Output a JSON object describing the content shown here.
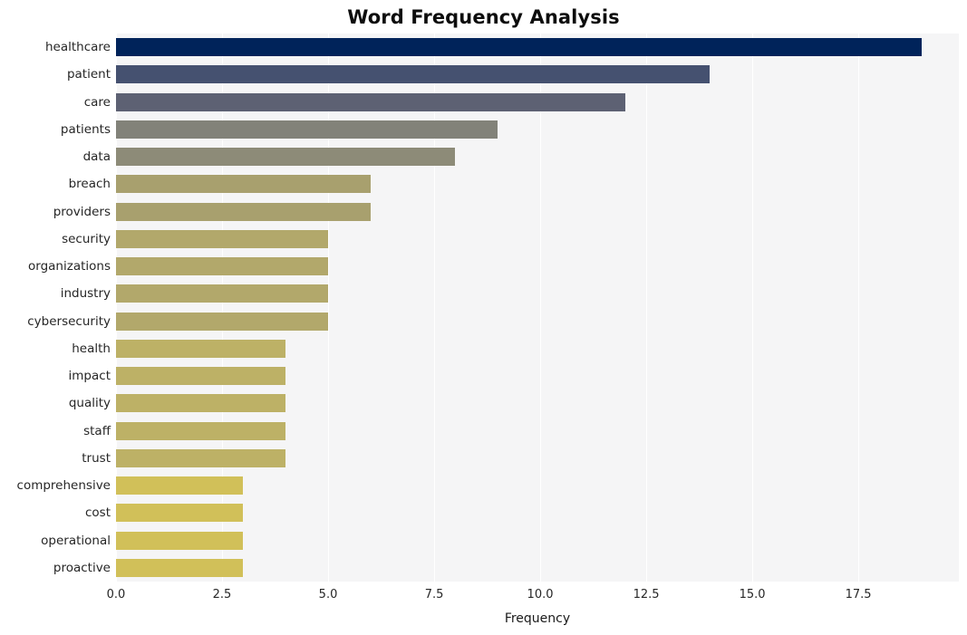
{
  "chart_data": {
    "type": "bar",
    "orientation": "horizontal",
    "title": "Word Frequency Analysis",
    "xlabel": "Frequency",
    "ylabel": "",
    "categories": [
      "healthcare",
      "patient",
      "care",
      "patients",
      "data",
      "breach",
      "providers",
      "security",
      "organizations",
      "industry",
      "cybersecurity",
      "health",
      "impact",
      "quality",
      "staff",
      "trust",
      "comprehensive",
      "cost",
      "operational",
      "proactive"
    ],
    "values": [
      19,
      14,
      12,
      9,
      8,
      6,
      6,
      5,
      5,
      5,
      5,
      4,
      4,
      4,
      4,
      4,
      3,
      3,
      3,
      3
    ],
    "bar_colors": [
      "#00235a",
      "#455170",
      "#5d6173",
      "#828279",
      "#8d8b78",
      "#a8a06e",
      "#a8a06e",
      "#b2a86b",
      "#b2a86b",
      "#b2a86b",
      "#b2a86b",
      "#bdb166",
      "#bdb166",
      "#bdb166",
      "#bdb166",
      "#bdb166",
      "#d1c059",
      "#d1c059",
      "#d1c059",
      "#d1c059"
    ],
    "xticks": [
      "0.0",
      "2.5",
      "5.0",
      "7.5",
      "10.0",
      "12.5",
      "15.0",
      "17.5"
    ],
    "xtick_values": [
      0,
      2.5,
      5,
      7.5,
      10,
      12.5,
      15,
      17.5
    ],
    "xlim": [
      0,
      19.87
    ],
    "grid": true,
    "legend": null,
    "plot_background": "#f5f5f6",
    "figure_background": "#ffffff",
    "gridline_color": "#ffffff"
  }
}
